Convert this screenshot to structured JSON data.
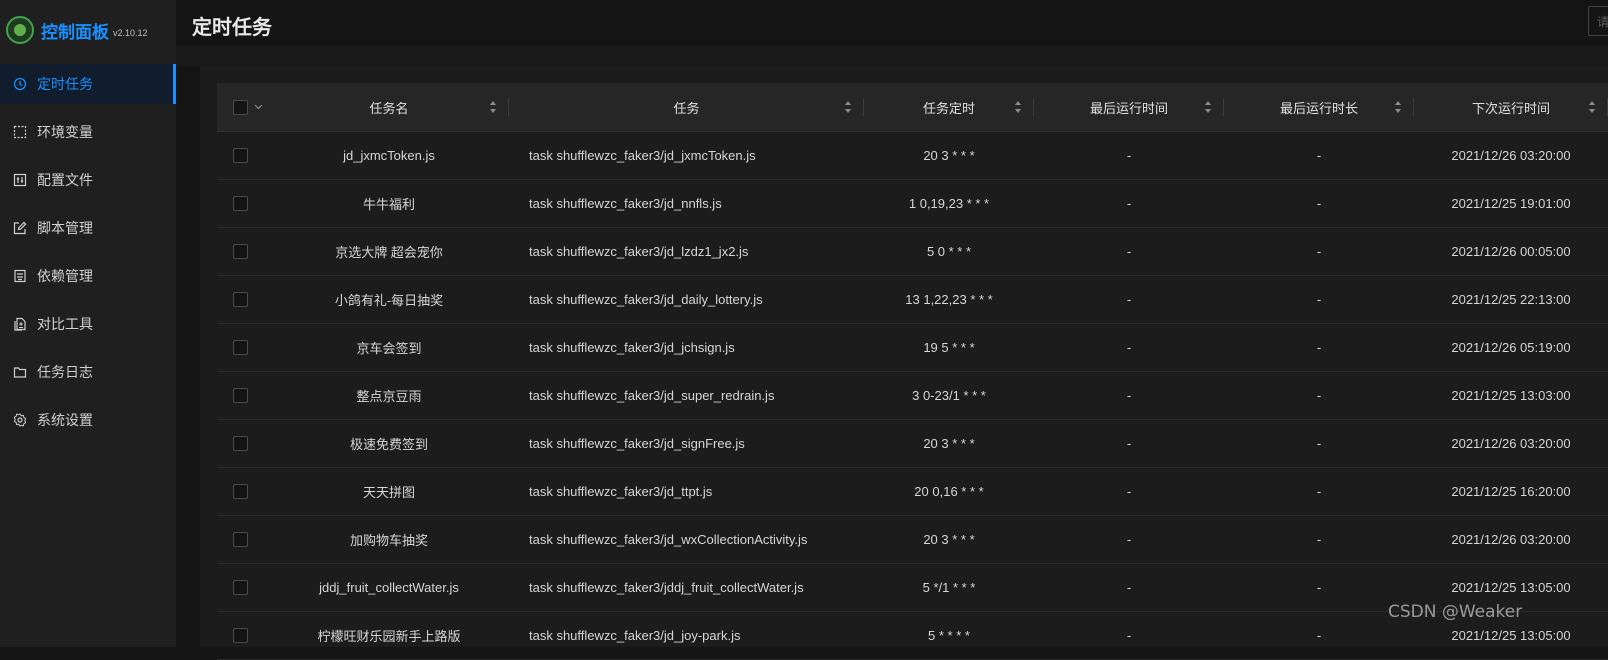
{
  "app": {
    "title": "控制面板",
    "version": "v2.10.12"
  },
  "page_title": "定时任务",
  "search": {
    "placeholder": "请"
  },
  "sidebar": {
    "items": [
      {
        "label": "定时任务",
        "icon": "clock-icon",
        "active": true
      },
      {
        "label": "环境变量",
        "icon": "dashed-box-icon"
      },
      {
        "label": "配置文件",
        "icon": "control-icon"
      },
      {
        "label": "脚本管理",
        "icon": "edit-icon"
      },
      {
        "label": "依赖管理",
        "icon": "container-icon"
      },
      {
        "label": "对比工具",
        "icon": "diff-icon"
      },
      {
        "label": "任务日志",
        "icon": "folder-icon"
      },
      {
        "label": "系统设置",
        "icon": "setting-icon"
      }
    ]
  },
  "table": {
    "columns": [
      "任务名",
      "任务",
      "任务定时",
      "最后运行时间",
      "最后运行时长",
      "下次运行时间"
    ],
    "rows": [
      {
        "name": "jd_jxmcToken.js",
        "command": "task shufflewzc_faker3/jd_jxmcToken.js",
        "schedule": "20 3 * * *",
        "last_run": "-",
        "last_duration": "-",
        "next_run": "2021/12/26 03:20:00"
      },
      {
        "name": "牛牛福利",
        "command": "task shufflewzc_faker3/jd_nnfls.js",
        "schedule": "1 0,19,23 * * *",
        "last_run": "-",
        "last_duration": "-",
        "next_run": "2021/12/25 19:01:00"
      },
      {
        "name": "京选大牌 超会宠你",
        "command": "task shufflewzc_faker3/jd_lzdz1_jx2.js",
        "schedule": "5 0 * * *",
        "last_run": "-",
        "last_duration": "-",
        "next_run": "2021/12/26 00:05:00"
      },
      {
        "name": "小鸽有礼-每日抽奖",
        "command": "task shufflewzc_faker3/jd_daily_lottery.js",
        "schedule": "13 1,22,23 * * *",
        "last_run": "-",
        "last_duration": "-",
        "next_run": "2021/12/25 22:13:00"
      },
      {
        "name": "京车会签到",
        "command": "task shufflewzc_faker3/jd_jchsign.js",
        "schedule": "19 5 * * *",
        "last_run": "-",
        "last_duration": "-",
        "next_run": "2021/12/26 05:19:00"
      },
      {
        "name": "整点京豆雨",
        "command": "task shufflewzc_faker3/jd_super_redrain.js",
        "schedule": "3 0-23/1 * * *",
        "last_run": "-",
        "last_duration": "-",
        "next_run": "2021/12/25 13:03:00"
      },
      {
        "name": "极速免费签到",
        "command": "task shufflewzc_faker3/jd_signFree.js",
        "schedule": "20 3 * * *",
        "last_run": "-",
        "last_duration": "-",
        "next_run": "2021/12/26 03:20:00"
      },
      {
        "name": "天天拼图",
        "command": "task shufflewzc_faker3/jd_ttpt.js",
        "schedule": "20 0,16 * * *",
        "last_run": "-",
        "last_duration": "-",
        "next_run": "2021/12/25 16:20:00"
      },
      {
        "name": "加购物车抽奖",
        "command": "task shufflewzc_faker3/jd_wxCollectionActivity.js",
        "schedule": "20 3 * * *",
        "last_run": "-",
        "last_duration": "-",
        "next_run": "2021/12/26 03:20:00"
      },
      {
        "name": "jddj_fruit_collectWater.js",
        "command": "task shufflewzc_faker3/jddj_fruit_collectWater.js",
        "schedule": "5 */1 * * *",
        "last_run": "-",
        "last_duration": "-",
        "next_run": "2021/12/25 13:05:00"
      },
      {
        "name": "柠檬旺财乐园新手上路版",
        "command": "task shufflewzc_faker3/jd_joy-park.js",
        "schedule": "5 * * * *",
        "last_run": "-",
        "last_duration": "-",
        "next_run": "2021/12/25 13:05:00"
      }
    ]
  },
  "watermark": "CSDN @Weaker"
}
